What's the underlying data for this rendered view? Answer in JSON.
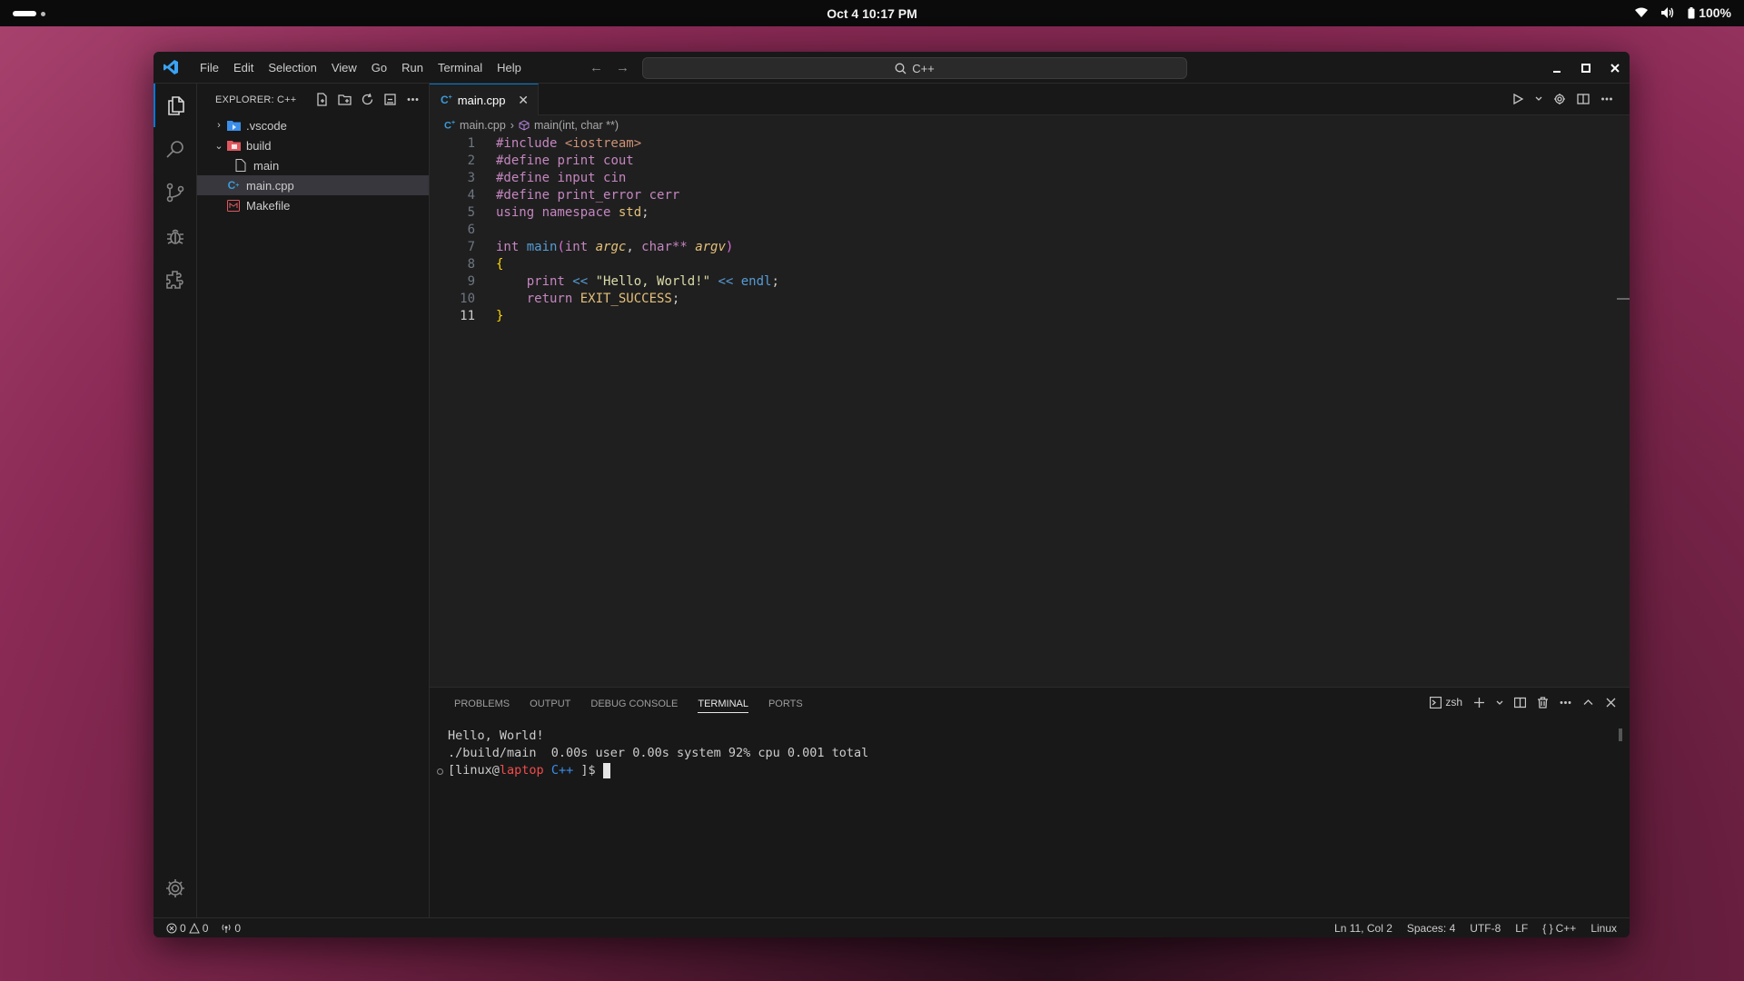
{
  "system": {
    "clock": "Oct 4  10:17 PM",
    "battery": "100%"
  },
  "titlebar": {
    "menu": [
      "File",
      "Edit",
      "Selection",
      "View",
      "Go",
      "Run",
      "Terminal",
      "Help"
    ],
    "search": "C++"
  },
  "sidebar": {
    "title": "EXPLORER: C++",
    "items": [
      {
        "label": ".vscode",
        "type": "folder",
        "expanded": false
      },
      {
        "label": "build",
        "type": "folder",
        "expanded": true
      },
      {
        "label": "main",
        "type": "file"
      },
      {
        "label": "main.cpp",
        "type": "cpp"
      },
      {
        "label": "Makefile",
        "type": "makefile"
      }
    ]
  },
  "editor": {
    "tab_label": "main.cpp",
    "breadcrumb": {
      "file": "main.cpp",
      "symbol": "main(int, char **)"
    },
    "line_numbers": [
      "1",
      "2",
      "3",
      "4",
      "5",
      "6",
      "7",
      "8",
      "9",
      "10",
      "11"
    ],
    "code": {
      "l1_a": "#include ",
      "l1_b": "<iostream>",
      "l2_a": "#define ",
      "l2_b": "print ",
      "l2_c": "cout",
      "l3_a": "#define ",
      "l3_b": "input ",
      "l3_c": "cin",
      "l4_a": "#define ",
      "l4_b": "print_error ",
      "l4_c": "cerr",
      "l5_a": "using ",
      "l5_b": "namespace ",
      "l5_c": "std",
      "l5_d": ";",
      "l7_a": "int ",
      "l7_b": "main",
      "l7_c": "(",
      "l7_d": "int ",
      "l7_e": "argc",
      "l7_f": ", ",
      "l7_g": "char",
      "l7_h": "** ",
      "l7_i": "argv",
      "l7_j": ")",
      "l8": "{",
      "l9_a": "    print ",
      "l9_b": "<< ",
      "l9_c": "\"Hello, World!\"",
      "l9_d": " << ",
      "l9_e": "endl",
      "l9_f": ";",
      "l10_a": "    return ",
      "l10_b": "EXIT_SUCCESS",
      "l10_c": ";",
      "l11": "}"
    }
  },
  "panel": {
    "tabs": [
      "PROBLEMS",
      "OUTPUT",
      "DEBUG CONSOLE",
      "TERMINAL",
      "PORTS"
    ],
    "active_tab": "TERMINAL",
    "shell": "zsh",
    "terminal": {
      "line1": "Hello, World!",
      "line2": "./build/main  0.00s user 0.00s system 92% cpu 0.001 total",
      "prompt_a": "[linux@",
      "prompt_host": "laptop",
      "prompt_b": " ",
      "prompt_dir": "C++",
      "prompt_c": " ]$ "
    }
  },
  "statusbar": {
    "errors": "0",
    "warnings": "0",
    "ports": "0",
    "position": "Ln 11, Col 2",
    "spaces": "Spaces: 4",
    "encoding": "UTF-8",
    "eol": "LF",
    "language": "C++",
    "platform": "Linux"
  },
  "colors": {
    "accent": "#0078d4",
    "background": "#1f1f1f",
    "sidebar": "#181818"
  }
}
